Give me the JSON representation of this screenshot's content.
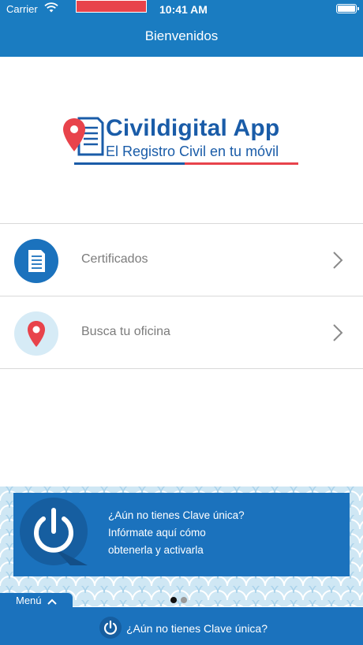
{
  "status_bar": {
    "carrier": "Carrier",
    "time": "10:41 AM"
  },
  "header": {
    "title": "Bienvenidos"
  },
  "logo": {
    "title": "Civildigital App",
    "subtitle": "El Registro Civil en tu móvil"
  },
  "menu_items": [
    {
      "label": "Certificados",
      "icon": "document-icon"
    },
    {
      "label": "Busca tu oficina",
      "icon": "location-pin-icon"
    }
  ],
  "banner": {
    "lines": [
      "¿Aún no tienes Clave única?",
      "Infórmate aquí cómo",
      "obtenerla y activarla"
    ],
    "icon": "power-icon",
    "page_count": 2,
    "active_page": 1
  },
  "footer": {
    "menu_label": "Menú",
    "cta_label": "¿Aún no tienes Clave única?"
  },
  "colors": {
    "header": "#1a7cc1",
    "banner": "#1b72bd",
    "brand_blue": "#1a5ca8",
    "brand_red": "#e8434b"
  }
}
